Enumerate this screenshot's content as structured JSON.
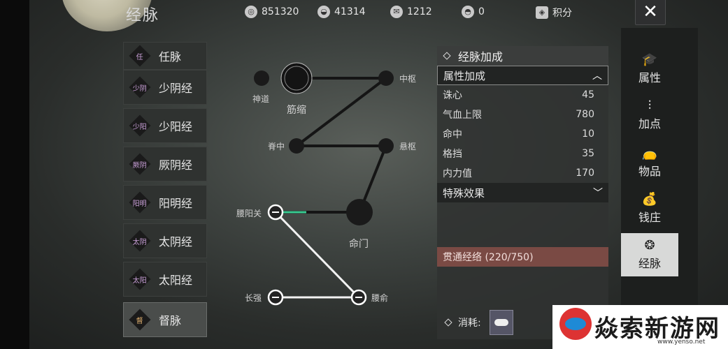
{
  "header": {
    "title": "经脉",
    "currencies": [
      {
        "icon": "silver-coin-icon",
        "value": "851320"
      },
      {
        "icon": "silver-ingot-icon",
        "value": "41314"
      },
      {
        "icon": "jade-ticket-icon",
        "value": "1212"
      },
      {
        "icon": "gold-ingot-icon",
        "value": "0"
      }
    ],
    "points_label": "积分",
    "close_icon": "close-icon"
  },
  "meridians": [
    {
      "badge": "任",
      "label": "任脉"
    },
    {
      "badge": "少阴",
      "label": "少阴经"
    },
    {
      "badge": "少阳",
      "label": "少阳经"
    },
    {
      "badge": "厥阴",
      "label": "厥阴经"
    },
    {
      "badge": "阳明",
      "label": "阳明经"
    },
    {
      "badge": "太阴",
      "label": "太阴经"
    },
    {
      "badge": "太阳",
      "label": "太阳经"
    },
    {
      "badge": "督",
      "label": "督脉"
    }
  ],
  "selected_meridian": "督脉",
  "acupoints": {
    "shendao": "神道",
    "jinsuo": "筋缩",
    "zhongshu": "中枢",
    "jizhong": "脊中",
    "xuanshu": "悬枢",
    "yaoyangguan": "腰阳关",
    "mingmen": "命门",
    "changqiang": "长强",
    "yaoshu": "腰俞"
  },
  "panel": {
    "title": "经脉加成",
    "attr_section": "属性加成",
    "attributes": [
      {
        "name": "诛心",
        "value": "45"
      },
      {
        "name": "气血上限",
        "value": "780"
      },
      {
        "name": "命中",
        "value": "10"
      },
      {
        "name": "格挡",
        "value": "35"
      },
      {
        "name": "内力值",
        "value": "170"
      }
    ],
    "special_section": "特殊效果",
    "progress_text": "贯通经络 (220/750)",
    "progress": {
      "current": 220,
      "total": 750
    },
    "cost_label": "消耗:"
  },
  "nav": [
    {
      "icon": "mortarboard-icon",
      "label": "属性"
    },
    {
      "icon": "sliders-icon",
      "label": "加点"
    },
    {
      "icon": "bag-icon",
      "label": "物品"
    },
    {
      "icon": "money-bag-icon",
      "label": "钱庄"
    },
    {
      "icon": "meridian-icon",
      "label": "经脉",
      "active": true
    }
  ],
  "watermark": {
    "text": "焱索新游网",
    "url": "www.yenso.net"
  }
}
